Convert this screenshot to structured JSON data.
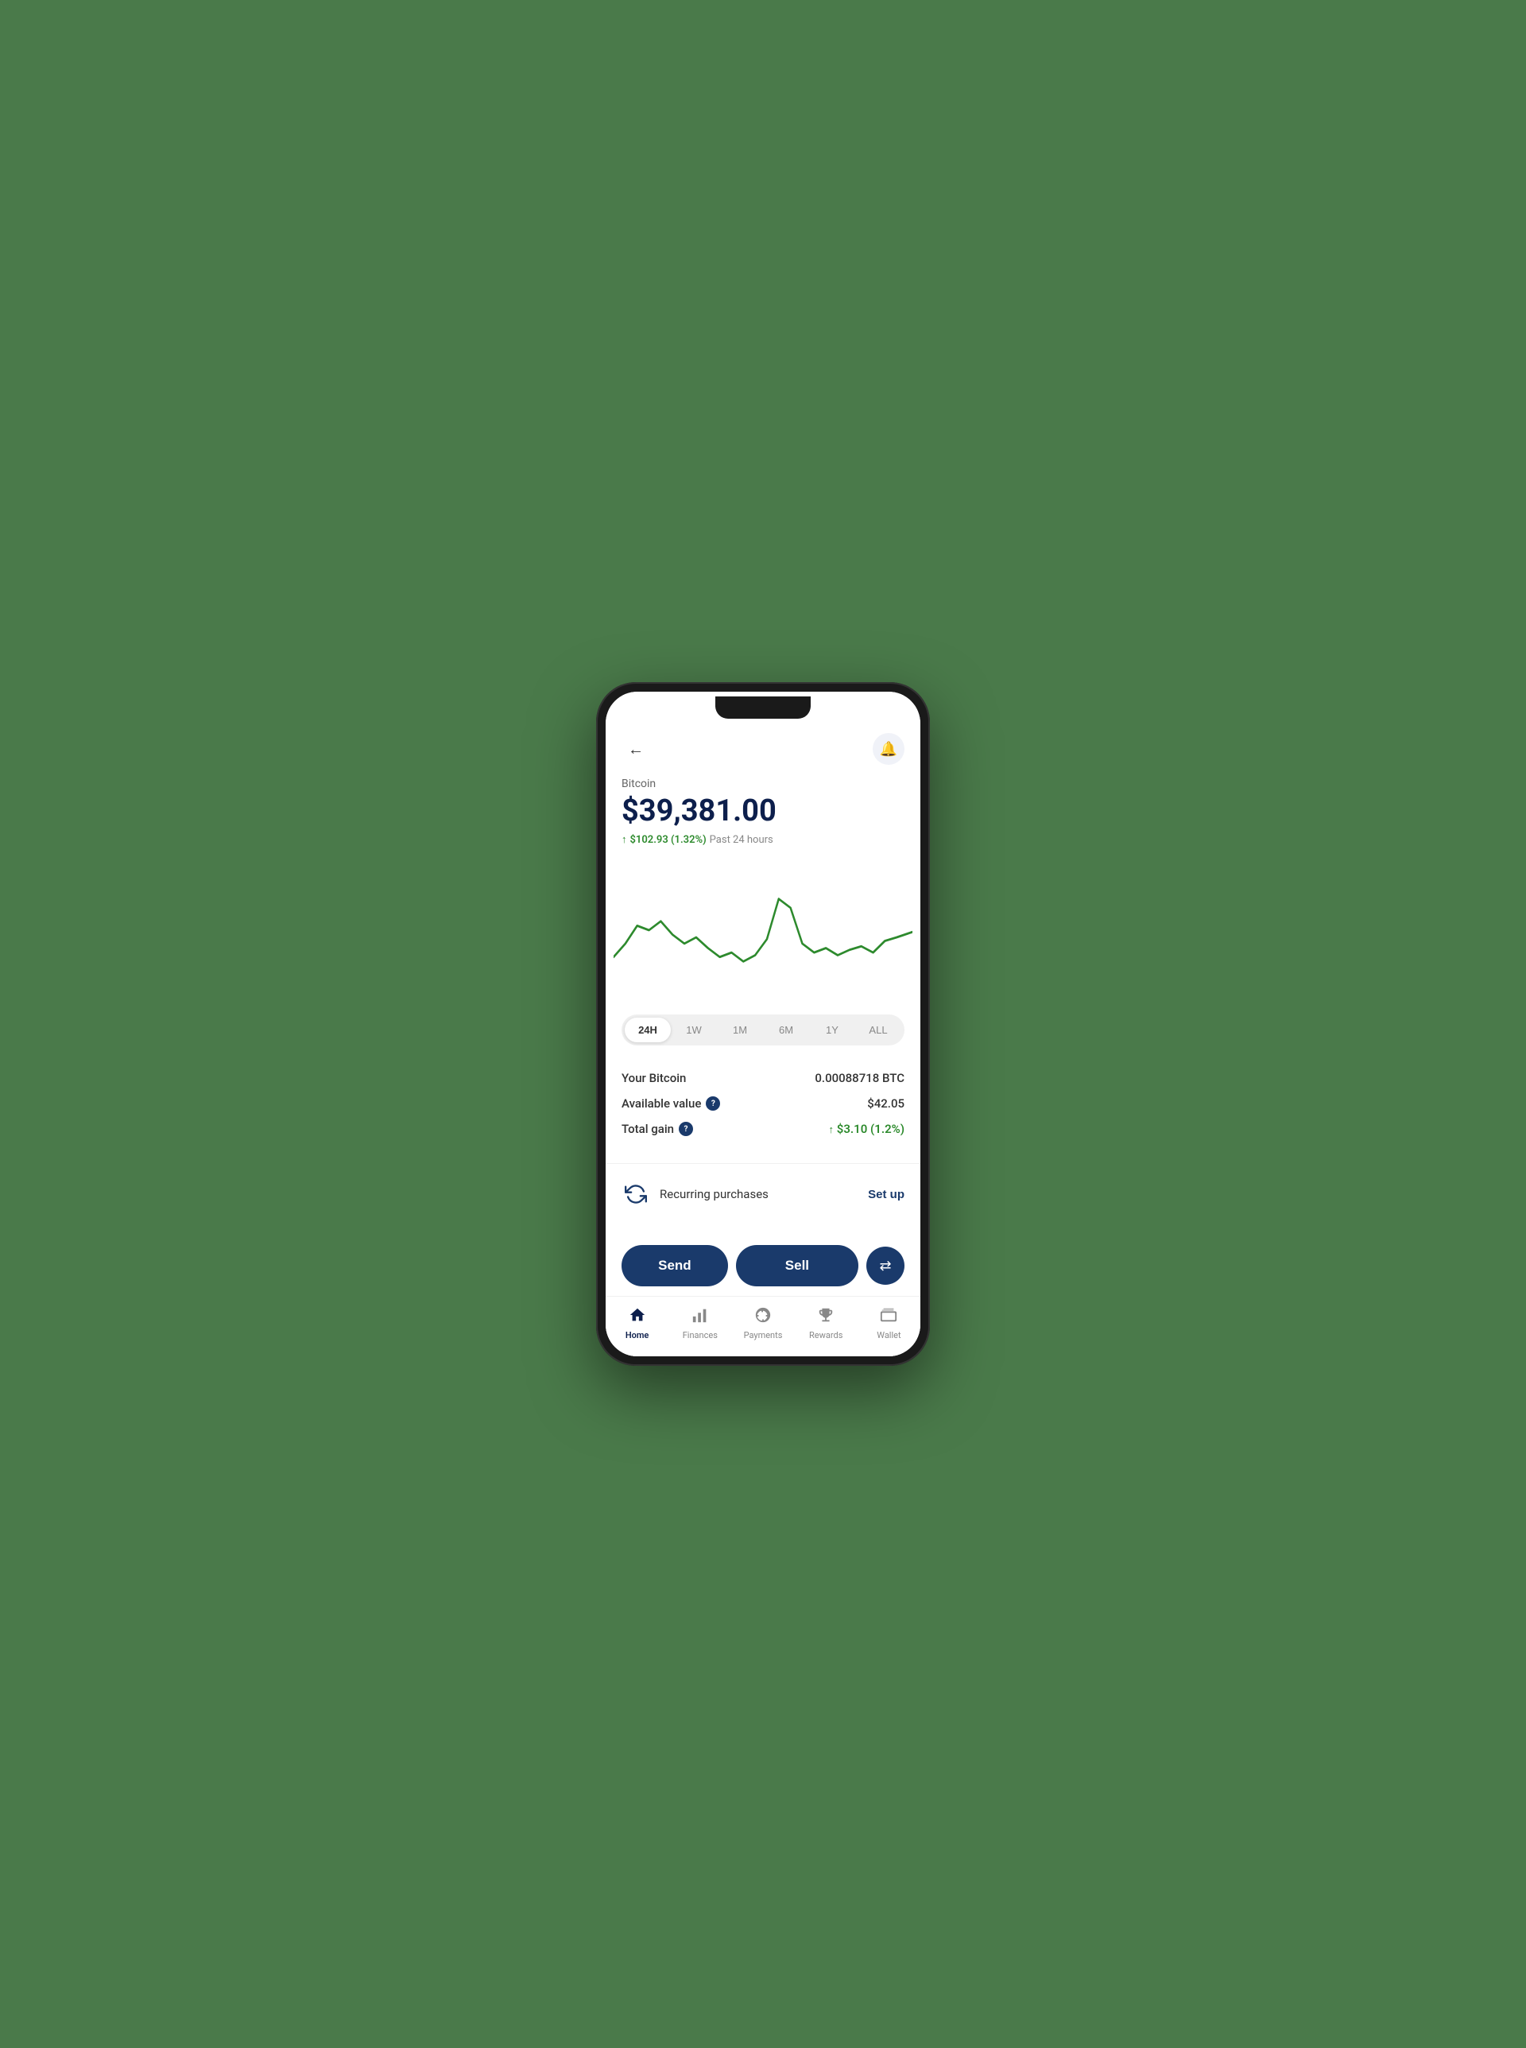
{
  "header": {
    "back_label": "←",
    "bell_label": "🔔"
  },
  "coin": {
    "name": "Bitcoin",
    "price": "$39,381.00",
    "change_amount": "$102.93",
    "change_percent": "(1.32%)",
    "change_period": "Past 24 hours"
  },
  "time_filters": [
    {
      "label": "24H",
      "active": true
    },
    {
      "label": "1W",
      "active": false
    },
    {
      "label": "1M",
      "active": false
    },
    {
      "label": "6M",
      "active": false
    },
    {
      "label": "1Y",
      "active": false
    },
    {
      "label": "ALL",
      "active": false
    }
  ],
  "holdings": {
    "your_bitcoin_label": "Your Bitcoin",
    "your_bitcoin_value": "0.00088718 BTC",
    "available_value_label": "Available value",
    "available_value_help": "?",
    "available_value": "$42.05",
    "total_gain_label": "Total gain",
    "total_gain_help": "?",
    "total_gain_amount": "$3.10",
    "total_gain_percent": "(1.2%)"
  },
  "recurring": {
    "label": "Recurring purchases",
    "setup_label": "Set up"
  },
  "actions": {
    "send_label": "Send",
    "sell_label": "Sell",
    "swap_icon": "⇄"
  },
  "bottom_nav": [
    {
      "label": "Home",
      "active": true,
      "icon": "home"
    },
    {
      "label": "Finances",
      "active": false,
      "icon": "finances"
    },
    {
      "label": "Payments",
      "active": false,
      "icon": "payments"
    },
    {
      "label": "Rewards",
      "active": false,
      "icon": "rewards"
    },
    {
      "label": "Wallet",
      "active": false,
      "icon": "wallet"
    }
  ]
}
